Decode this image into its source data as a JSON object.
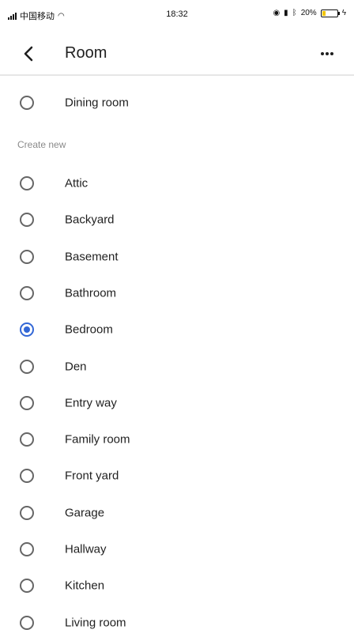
{
  "status_bar": {
    "carrier": "中国移动",
    "time": "18:32",
    "battery_percent": "20%",
    "battery_level": 0.2
  },
  "header": {
    "title": "Room",
    "more_glyph": "•••"
  },
  "current": {
    "label": "Dining room",
    "checked": false
  },
  "section_label": "Create new",
  "options": [
    {
      "label": "Attic",
      "checked": false
    },
    {
      "label": "Backyard",
      "checked": false
    },
    {
      "label": "Basement",
      "checked": false
    },
    {
      "label": "Bathroom",
      "checked": false
    },
    {
      "label": "Bedroom",
      "checked": true
    },
    {
      "label": "Den",
      "checked": false
    },
    {
      "label": "Entry way",
      "checked": false
    },
    {
      "label": "Family room",
      "checked": false
    },
    {
      "label": "Front yard",
      "checked": false
    },
    {
      "label": "Garage",
      "checked": false
    },
    {
      "label": "Hallway",
      "checked": false
    },
    {
      "label": "Kitchen",
      "checked": false
    },
    {
      "label": "Living room",
      "checked": false
    }
  ],
  "colors": {
    "accent": "#3367d6",
    "radio_border": "#666666",
    "divider": "#e6e6e6",
    "battery": "#f2c400"
  }
}
